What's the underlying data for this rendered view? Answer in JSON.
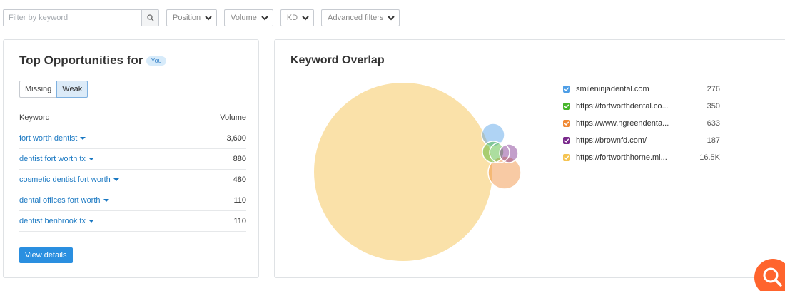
{
  "filters": {
    "search_placeholder": "Filter by keyword",
    "position_label": "Position",
    "volume_label": "Volume",
    "kd_label": "KD",
    "advanced_label": "Advanced filters"
  },
  "opportunities": {
    "title": "Top Opportunities for",
    "badge": "You",
    "tabs": [
      "Missing",
      "Weak"
    ],
    "active_tab": "Weak",
    "col_keyword": "Keyword",
    "col_volume": "Volume",
    "rows": [
      {
        "keyword": "fort worth dentist",
        "volume": "3,600"
      },
      {
        "keyword": "dentist fort worth tx",
        "volume": "880"
      },
      {
        "keyword": "cosmetic dentist fort worth",
        "volume": "480"
      },
      {
        "keyword": "dental offices fort worth",
        "volume": "110"
      },
      {
        "keyword": "dentist benbrook tx",
        "volume": "110"
      }
    ],
    "button": "View details"
  },
  "overlap": {
    "title": "Keyword Overlap",
    "legend": [
      {
        "label": "smileninjadental.com",
        "value": "276",
        "color": "#4e9ee6"
      },
      {
        "label": "https://fortworthdental.co...",
        "value": "350",
        "color": "#47b52b"
      },
      {
        "label": "https://www.ngreendenta...",
        "value": "633",
        "color": "#f08a36"
      },
      {
        "label": "https://brownfd.com/",
        "value": "187",
        "color": "#7a2a8c"
      },
      {
        "label": "https://fortworthhorne.mi...",
        "value": "16.5K",
        "color": "#f5c453"
      }
    ]
  },
  "icons": {
    "search": "search-icon",
    "chevron": "chevron-down-icon",
    "help": "help-search-icon"
  }
}
